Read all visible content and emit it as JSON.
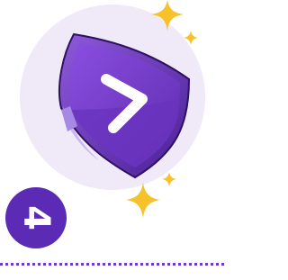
{
  "step": {
    "number": "4"
  },
  "icons": {
    "shield": "shield-chevron-icon",
    "sparkle_large_top": "sparkle-icon",
    "sparkle_small_top": "sparkle-icon",
    "sparkle_large_bottom": "sparkle-icon",
    "sparkle_small_bottom": "sparkle-icon"
  },
  "colors": {
    "halo": "#efe9f8",
    "shield_rim": "#5a2ba8",
    "shield_face": "#7b3fd0",
    "sparkle": "#f6c12b",
    "badge": "#5b2bb5",
    "divider": "#6a3fc4"
  }
}
